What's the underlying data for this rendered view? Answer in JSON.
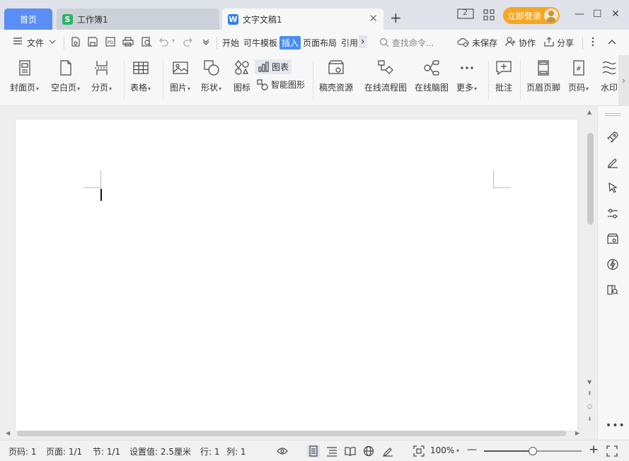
{
  "titlebar": {
    "home_tab": "首页",
    "sheet_tab": "工作簿1",
    "sheet_badge": "S",
    "doc_tab": "文字文稿1",
    "doc_badge": "W",
    "close_glyph": "✕",
    "add_glyph": "+",
    "login_label": "立即登录",
    "screen_badge": "2",
    "minimize_glyph": "—",
    "maximize_glyph": "☐",
    "window_close_glyph": "✕"
  },
  "menubar": {
    "file_label": "文件",
    "items": [
      "开始",
      "可牛模板",
      "插入",
      "页面布局",
      "引用"
    ],
    "active_item": "插入",
    "more_glyph": "›",
    "search_placeholder": "查找命令...",
    "unsaved_label": "未保存",
    "collab_label": "协作",
    "share_label": "分享"
  },
  "ribbon": {
    "cover_page": "封面页",
    "blank_page": "空白页",
    "page_break": "分页",
    "table": "表格",
    "picture": "图片",
    "shape": "形状",
    "icon": "图标",
    "chart": "图表",
    "smart_graphic": "智能图形",
    "resources": "稿壳资源",
    "flowchart": "在线流程图",
    "mindmap": "在线脑图",
    "more": "更多",
    "comment": "批注",
    "header_footer": "页眉页脚",
    "page_number": "页码",
    "watermark": "水印",
    "scroll_glyph": "›"
  },
  "statusbar": {
    "page_number": "页码: 1",
    "page": "页面: 1/1",
    "section": "节: 1/1",
    "setting": "设置值: 2.5厘米",
    "row": "行: 1",
    "col": "列: 1",
    "zoom": "100%",
    "zoom_level": 0.5,
    "zoom_minus": "—",
    "zoom_plus": "+"
  },
  "colors": {
    "home_tab": "#5b8ef5",
    "login_button": "#f5a623",
    "active_menu": "#4a8df0",
    "sheet_badge": "#2bb36b",
    "doc_badge": "#2d7ff0"
  }
}
